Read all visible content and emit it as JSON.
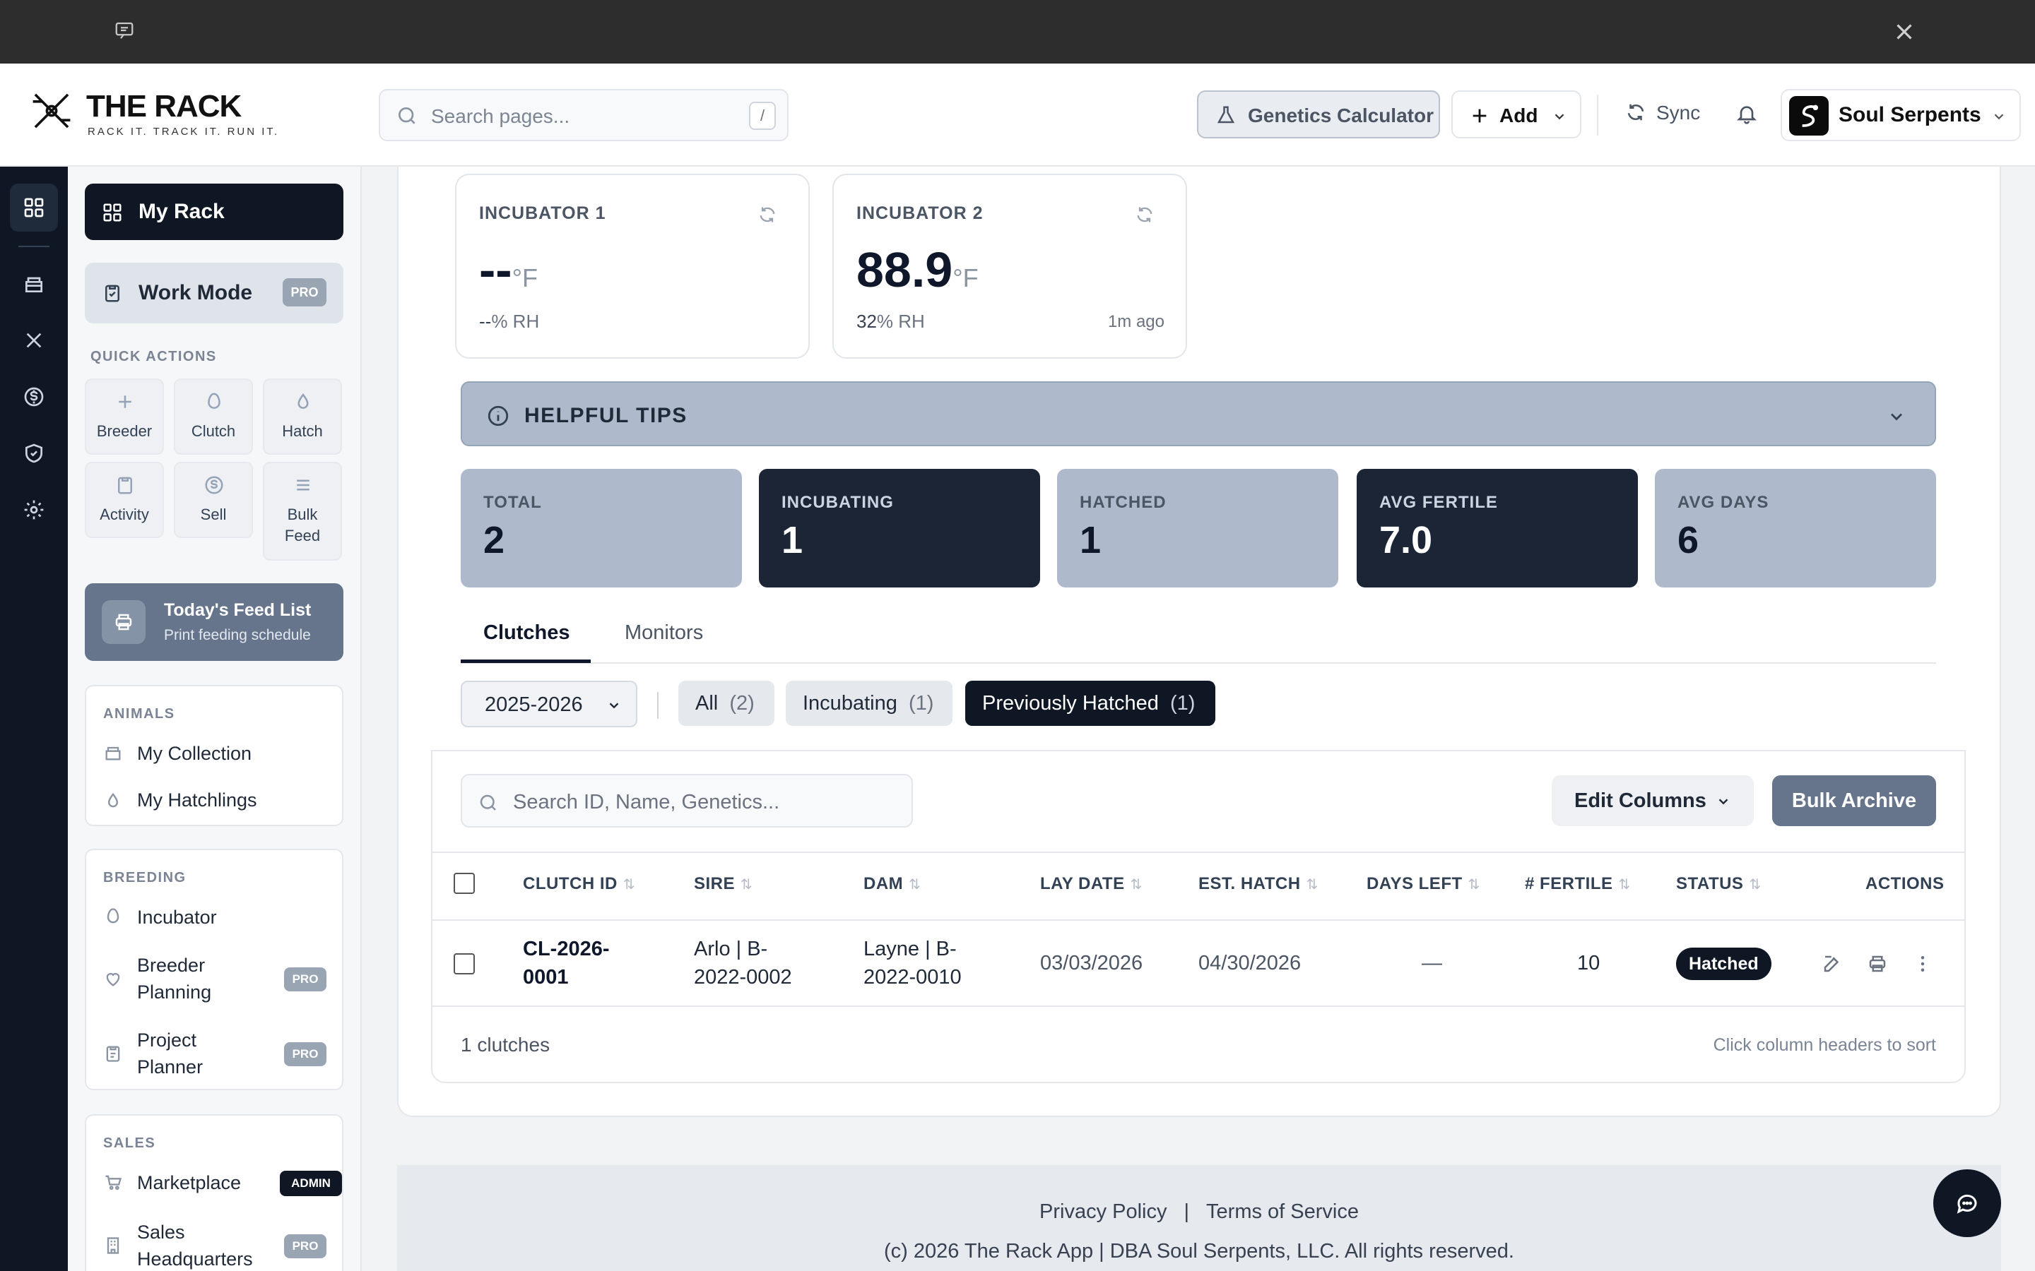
{
  "header": {
    "brand": "THE RACK",
    "tagline": "RACK IT. TRACK IT. RUN IT.",
    "search_placeholder": "Search pages...",
    "search_shortcut": "/",
    "genetics_label": "Genetics Calculator",
    "add_label": "Add",
    "sync_label": "Sync",
    "account_name": "Soul Serpents"
  },
  "sidebar": {
    "my_rack": "My Rack",
    "work_mode": "Work Mode",
    "pro": "PRO",
    "admin": "ADMIN",
    "quick_actions_title": "QUICK ACTIONS",
    "quick_actions": [
      {
        "label": "Breeder",
        "icon": "plus-icon"
      },
      {
        "label": "Clutch",
        "icon": "egg-icon"
      },
      {
        "label": "Hatch",
        "icon": "drop-icon"
      },
      {
        "label": "Activity",
        "icon": "clipboard-icon"
      },
      {
        "label": "Sell",
        "icon": "dollar-icon"
      },
      {
        "label": "Bulk Feed",
        "icon": "list-icon"
      }
    ],
    "feed_title": "Today's Feed List",
    "feed_sub": "Print feeding schedule",
    "animals_title": "ANIMALS",
    "my_collection": "My Collection",
    "my_hatchlings": "My Hatchlings",
    "breeding_title": "BREEDING",
    "incubator": "Incubator",
    "breeder_planning": "Breeder Planning",
    "project_planner": "Project Planner",
    "sales_title": "SALES",
    "marketplace": "Marketplace",
    "sales_hq": "Sales Headquarters"
  },
  "incubators": [
    {
      "name": "INCUBATOR 1",
      "temp": "--",
      "unit": "°F",
      "rh": "--",
      "rh_unit": "% RH",
      "ago": ""
    },
    {
      "name": "INCUBATOR 2",
      "temp": "88.9",
      "unit": "°F",
      "rh": "32",
      "rh_unit": "% RH",
      "ago": "1m ago"
    }
  ],
  "tips_label": "HELPFUL TIPS",
  "stats": [
    {
      "label": "TOTAL",
      "value": "2"
    },
    {
      "label": "INCUBATING",
      "value": "1"
    },
    {
      "label": "HATCHED",
      "value": "1"
    },
    {
      "label": "AVG FERTILE",
      "value": "7.0"
    },
    {
      "label": "AVG DAYS",
      "value": "6"
    }
  ],
  "tabs": [
    "Clutches",
    "Monitors"
  ],
  "filters": {
    "year": "2025-2026",
    "chips": [
      {
        "label": "All",
        "count": "(2)"
      },
      {
        "label": "Incubating",
        "count": "(1)"
      },
      {
        "label": "Previously Hatched",
        "count": "(1)"
      }
    ]
  },
  "table": {
    "search_placeholder": "Search ID, Name, Genetics...",
    "edit_columns": "Edit Columns",
    "bulk_archive": "Bulk Archive",
    "headers": [
      "CLUTCH ID",
      "SIRE",
      "DAM",
      "LAY DATE",
      "EST. HATCH",
      "DAYS LEFT",
      "# FERTILE",
      "STATUS",
      "ACTIONS"
    ],
    "sort_glyph": "⇅",
    "rows": [
      {
        "id_l1": "CL-2026-",
        "id_l2": "0001",
        "sire_l1": "Arlo | B-",
        "sire_l2": "2022-0002",
        "dam_l1": "Layne | B-",
        "dam_l2": "2022-0010",
        "lay": "03/03/2026",
        "est": "04/30/2026",
        "days": "—",
        "fertile": "10",
        "status": "Hatched"
      }
    ],
    "count_label": "1 clutches",
    "sort_hint": "Click column headers to sort"
  },
  "footer": {
    "privacy": "Privacy Policy",
    "sep": "|",
    "terms": "Terms of Service",
    "copyright": "(c) 2026 The Rack App | DBA Soul Serpents, LLC. All rights reserved."
  },
  "colors": {
    "dark": "#0f1724",
    "slate": "#66758b",
    "light_stat": "#aebacb"
  }
}
